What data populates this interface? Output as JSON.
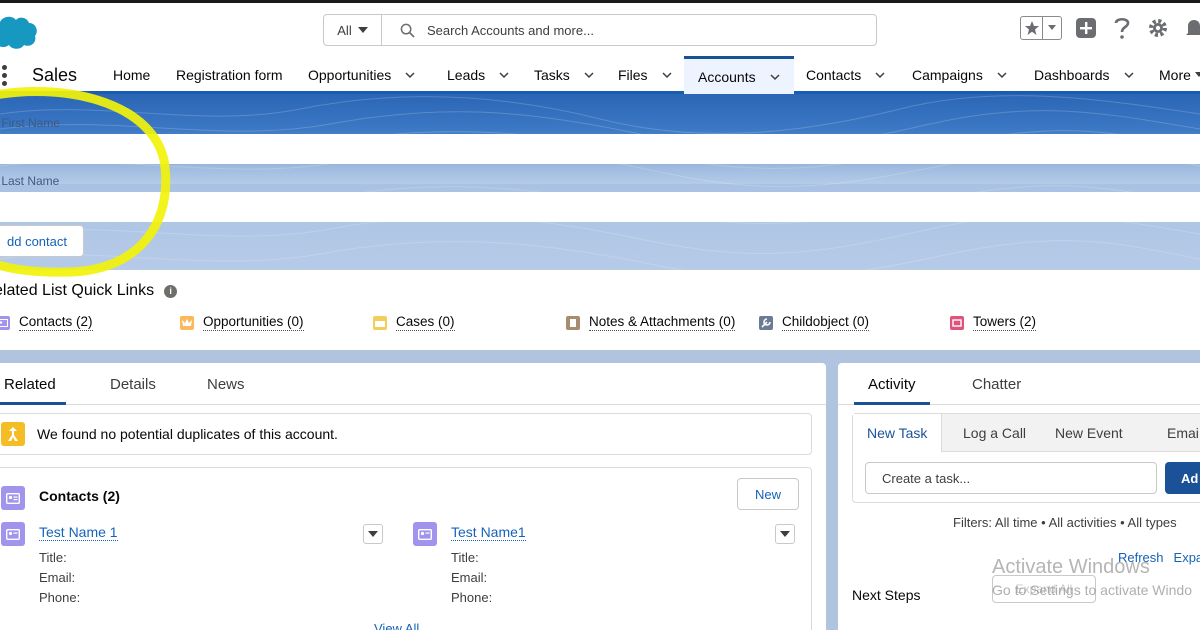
{
  "header": {
    "search_scope": "All",
    "search_placeholder": "Search Accounts and more..."
  },
  "nav": {
    "app_name": "Sales",
    "items": [
      {
        "label": "Home"
      },
      {
        "label": "Registration form"
      },
      {
        "label": "Opportunities"
      },
      {
        "label": "Leads"
      },
      {
        "label": "Tasks"
      },
      {
        "label": "Files"
      },
      {
        "label": "Accounts"
      },
      {
        "label": "Contacts"
      },
      {
        "label": "Campaigns"
      },
      {
        "label": "Dashboards"
      },
      {
        "label": "More"
      }
    ],
    "active": "Accounts"
  },
  "form": {
    "first_name_label": "r First Name",
    "last_name_label": "r Last Name",
    "add_button": "dd contact"
  },
  "quick_links": {
    "title": "elated List Quick Links",
    "info": "i",
    "items": [
      {
        "label": "Contacts (2)",
        "icon": "contact-icon",
        "color": "#a094ed"
      },
      {
        "label": "Opportunities (0)",
        "icon": "crown-icon",
        "color": "#fcb95b"
      },
      {
        "label": "Cases (0)",
        "icon": "case-icon",
        "color": "#f2cf5b"
      },
      {
        "label": "Notes & Attachments (0)",
        "icon": "note-icon",
        "color": "#a88c6f"
      },
      {
        "label": "Childobject (0)",
        "icon": "wrench-icon",
        "color": "#6b7b93"
      },
      {
        "label": "Towers (2)",
        "icon": "tower-icon",
        "color": "#e0537a"
      }
    ]
  },
  "main": {
    "tabs": [
      {
        "label": "Related"
      },
      {
        "label": "Details"
      },
      {
        "label": "News"
      }
    ],
    "duplicates_message": "We found no potential duplicates of this account.",
    "contacts_title": "Contacts (2)",
    "new_button": "New",
    "contacts": [
      {
        "name": "Test Name 1",
        "title": "Title:",
        "email": "Email:",
        "phone": "Phone:"
      },
      {
        "name": "Test Name1",
        "title": "Title:",
        "email": "Email:",
        "phone": "Phone:"
      }
    ],
    "view_all": "View All"
  },
  "activity": {
    "tabs": [
      {
        "label": "Activity"
      },
      {
        "label": "Chatter"
      }
    ],
    "publisher_tabs": [
      {
        "label": "New Task"
      },
      {
        "label": "Log a Call"
      },
      {
        "label": "New Event"
      },
      {
        "label": "Emai"
      }
    ],
    "task_placeholder": "Create a task...",
    "add_button": "Ad",
    "filters": "Filters: All time • All activities • All types",
    "refresh": "Refresh",
    "expand": "Expa",
    "expand_all": "Expand All",
    "next_steps": "Next Steps"
  },
  "watermark": {
    "title": "Activate Windows",
    "subtitle": "Go to Settings to activate Windo"
  },
  "colors": {
    "brand_blue": "#1b5297",
    "link_blue": "#1563b8",
    "banner_blue": "#2f6cba",
    "highlight": "#f2f20a"
  }
}
